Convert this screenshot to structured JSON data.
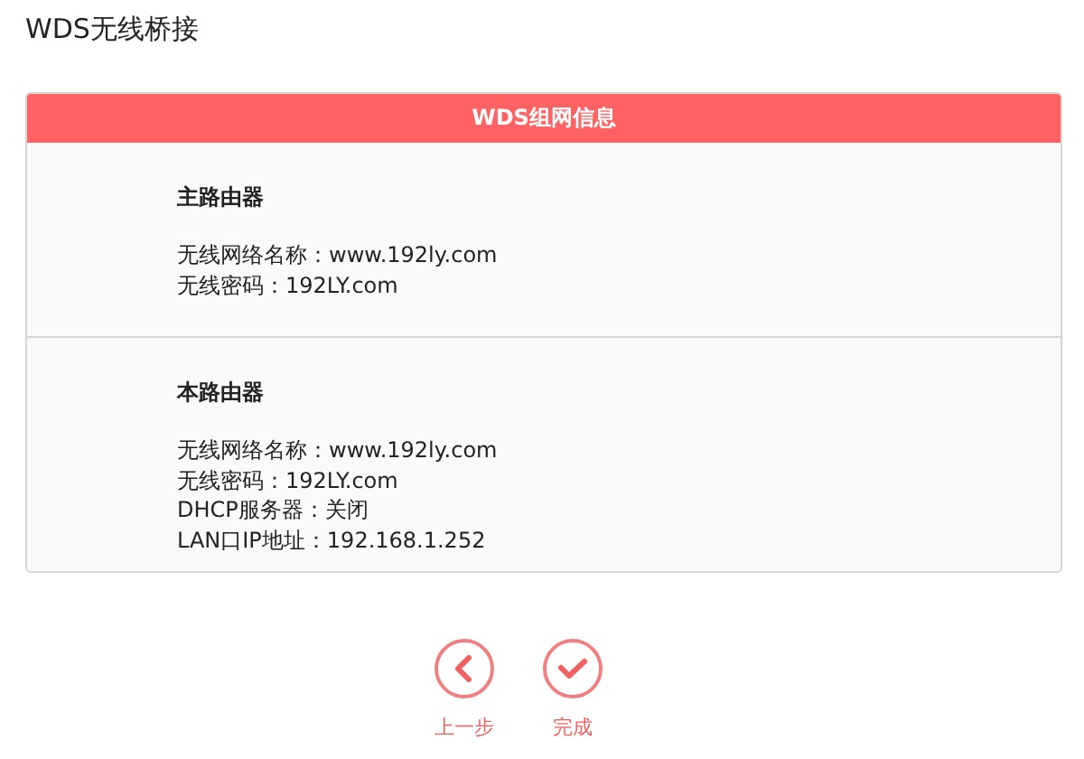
{
  "page": {
    "title": "WDS无线桥接"
  },
  "panel": {
    "title": "WDS组网信息",
    "sections": [
      {
        "heading": "主路由器",
        "lines": [
          "无线网络名称：www.192ly.com",
          "无线密码：192LY.com"
        ]
      },
      {
        "heading": "本路由器",
        "lines": [
          "无线网络名称：www.192ly.com",
          "无线密码：192LY.com",
          "DHCP服务器：关闭",
          "LAN口IP地址：192.168.1.252"
        ]
      }
    ]
  },
  "buttons": [
    {
      "kind": "back",
      "label": "上一步"
    },
    {
      "kind": "finish",
      "label": "完成"
    }
  ]
}
